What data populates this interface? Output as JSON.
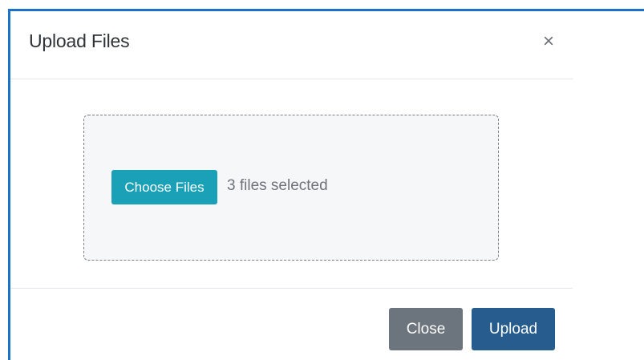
{
  "modal": {
    "title": "Upload Files",
    "close_icon": "close-icon",
    "close_symbol": "×"
  },
  "dropzone": {
    "choose_button_label": "Choose Files",
    "status_text": "3 files selected"
  },
  "footer": {
    "close_label": "Close",
    "upload_label": "Upload"
  },
  "colors": {
    "frame_border": "#1a73c9",
    "choose_button": "#1aa1b8",
    "close_button": "#6c757d",
    "upload_button": "#275d8e",
    "dropzone_bg": "#f6f7f9"
  }
}
